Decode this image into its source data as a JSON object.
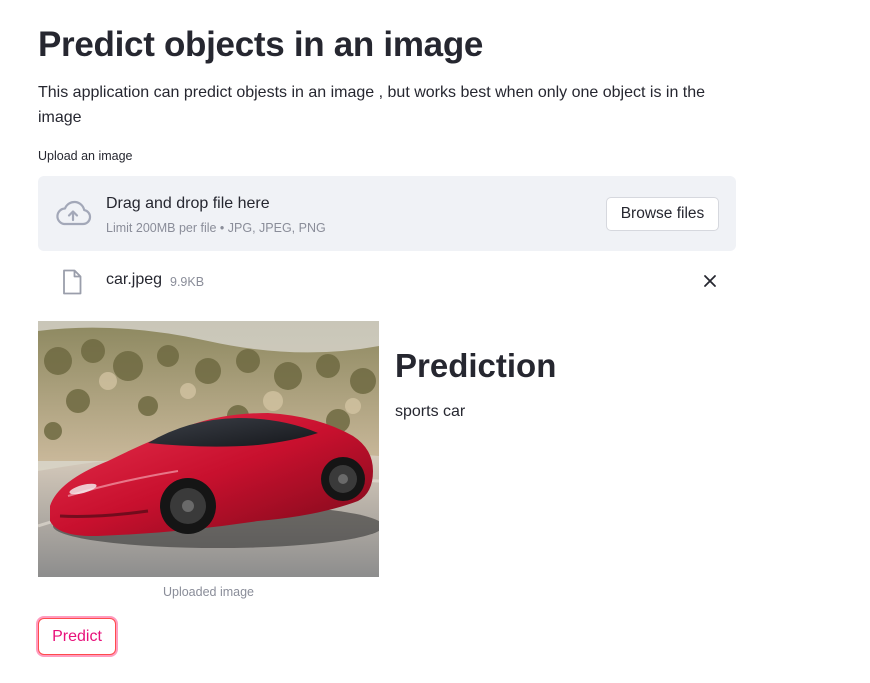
{
  "header": {
    "title": "Predict objects in an image",
    "description": "This application can predict objests in an image , but works best when only one object is in the image"
  },
  "uploader": {
    "label": "Upload an image",
    "drop_title": "Drag and drop file here",
    "limit_text": "Limit 200MB per file • JPG, JPEG, PNG",
    "browse_label": "Browse files",
    "icon": "cloud-upload-icon"
  },
  "uploaded_file": {
    "name": "car.jpeg",
    "size": "9.9KB",
    "icon": "file-icon",
    "remove_icon": "close-icon"
  },
  "image": {
    "caption": "Uploaded image"
  },
  "prediction": {
    "heading": "Prediction",
    "value": "sports car"
  },
  "actions": {
    "predict_label": "Predict"
  },
  "colors": {
    "primary": "#ff4b4b",
    "predict_text": "#e8107a",
    "dropzone_bg": "#f0f2f6",
    "text": "#262730",
    "muted": "#8a8d99"
  }
}
